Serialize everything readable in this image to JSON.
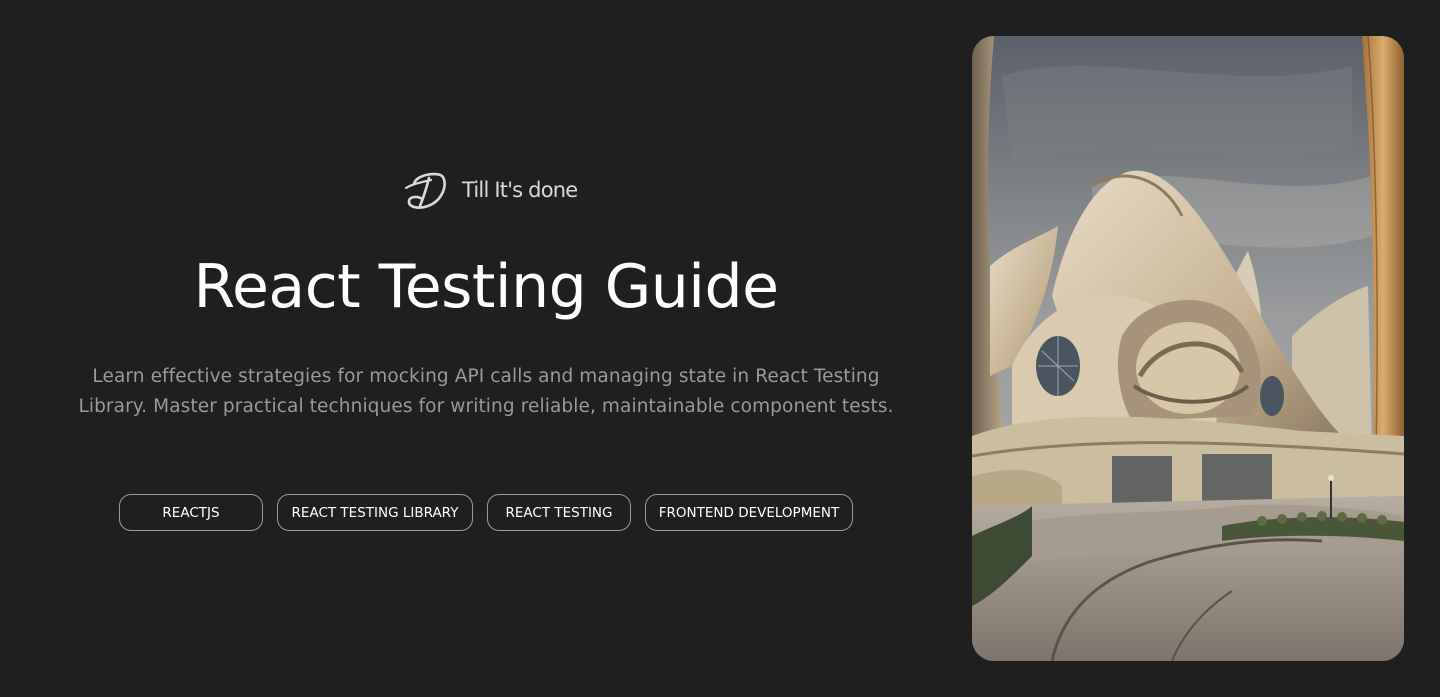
{
  "brand": {
    "logo_icon": "td-monogram-logo",
    "name": "Till It's done"
  },
  "hero": {
    "title": "React Testing Guide",
    "description": "Learn effective strategies for mocking API calls and managing state in React Testing Library. Master practical techniques for writing reliable, maintainable component tests."
  },
  "tags": [
    {
      "label": "REACTJS"
    },
    {
      "label": "REACT TESTING LIBRARY"
    },
    {
      "label": "REACT TESTING"
    },
    {
      "label": "FRONTEND DEVELOPMENT"
    }
  ],
  "cover_image": {
    "subject": "futuristic-curved-concrete-architecture"
  },
  "colors": {
    "background": "#1f1f1f",
    "title": "#ffffff",
    "description": "#9a9a9a",
    "tag_border": "#9a9a9a"
  }
}
